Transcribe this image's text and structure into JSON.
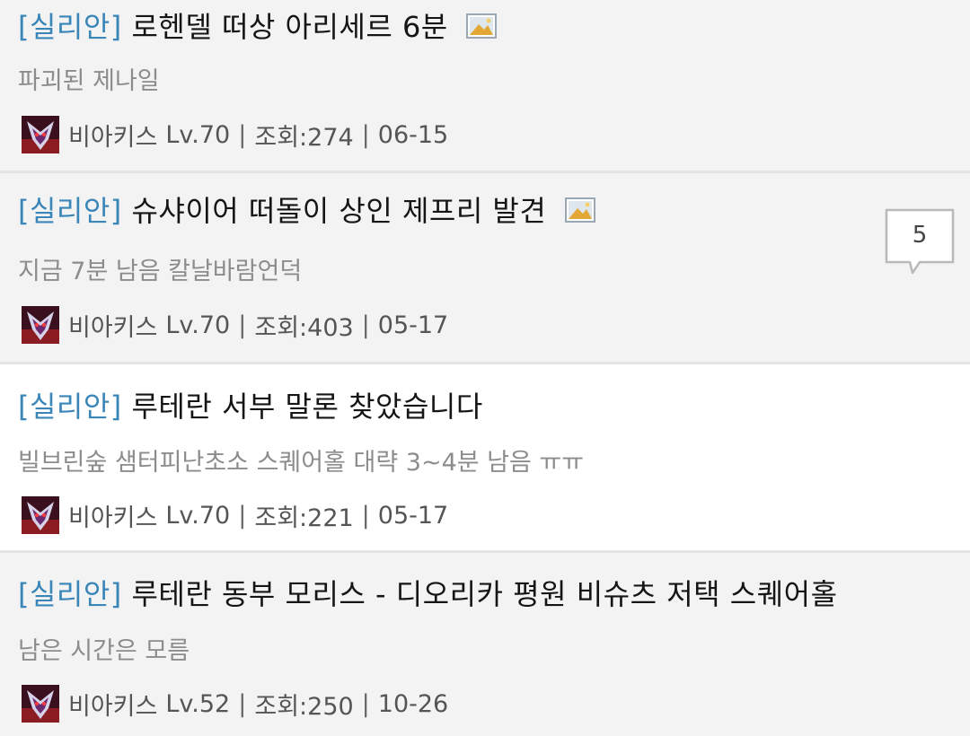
{
  "posts": [
    {
      "tag": "[실리안]",
      "title": "로헨델 떠상 아리세르 6분",
      "has_image": true,
      "description": "파괴된 제나일",
      "author": "비아키스",
      "level": "Lv.70",
      "views": "조회:274",
      "date": "06-15",
      "comments": null,
      "background": "#f3f3f3"
    },
    {
      "tag": "[실리안]",
      "title": "슈샤이어 떠돌이 상인 제프리 발견",
      "has_image": true,
      "description": "지금 7분 남음 칼날바람언덕",
      "author": "비아키스",
      "level": "Lv.70",
      "views": "조회:403",
      "date": "05-17",
      "comments": "5",
      "background": "#f3f3f3"
    },
    {
      "tag": "[실리안]",
      "title": "루테란 서부 말론 찾았습니다",
      "has_image": false,
      "description": "빌브린숲 샘터피난초소 스퀘어홀 대략 3~4분 남음 ㅠㅠ",
      "author": "비아키스",
      "level": "Lv.70",
      "views": "조회:221",
      "date": "05-17",
      "comments": null,
      "background": "#ffffff"
    },
    {
      "tag": "[실리안]",
      "title": "루테란 동부 모리스 - 디오리카 평원 비슈츠 저택 스퀘어홀",
      "has_image": false,
      "description": "남은 시간은 모름",
      "author": "비아키스",
      "level": "Lv.52",
      "views": "조회:250",
      "date": "10-26",
      "comments": null,
      "background": "#f3f3f3"
    }
  ],
  "icons": {
    "image_attachment": "image-icon",
    "avatar": "avatar-icon",
    "comment_bubble": "speech-bubble-icon"
  },
  "colors": {
    "tag": "#3b86b8",
    "title": "#151515",
    "description": "#8c8c8c",
    "meta": "#555555",
    "separator": "#e4e4e4"
  }
}
